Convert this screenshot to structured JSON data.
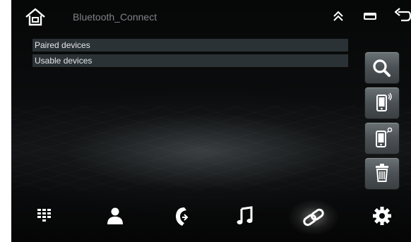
{
  "header": {
    "title": "Bluetooth_Connect",
    "home_icon": "home-icon",
    "collapse_icon": "double-chevron-up-icon",
    "window_icon": "window-icon",
    "back_icon": "back-arrow-icon"
  },
  "device_list": {
    "rows": [
      {
        "label": "Paired devices"
      },
      {
        "label": "Usable devices"
      }
    ]
  },
  "side_buttons": [
    {
      "icon": "search-icon"
    },
    {
      "icon": "phone-signal-icon"
    },
    {
      "icon": "phone-pair-icon"
    },
    {
      "icon": "trash-icon"
    }
  ],
  "bottom_nav": [
    {
      "icon": "dialpad-icon"
    },
    {
      "icon": "contacts-icon"
    },
    {
      "icon": "call-log-icon"
    },
    {
      "icon": "music-icon"
    },
    {
      "icon": "link-icon",
      "active": true
    },
    {
      "icon": "gear-icon"
    }
  ],
  "colors": {
    "background": "#0b0c0d",
    "row_bg": "#2b3235",
    "title_text": "#7e8487",
    "icon": "#ffffff"
  }
}
